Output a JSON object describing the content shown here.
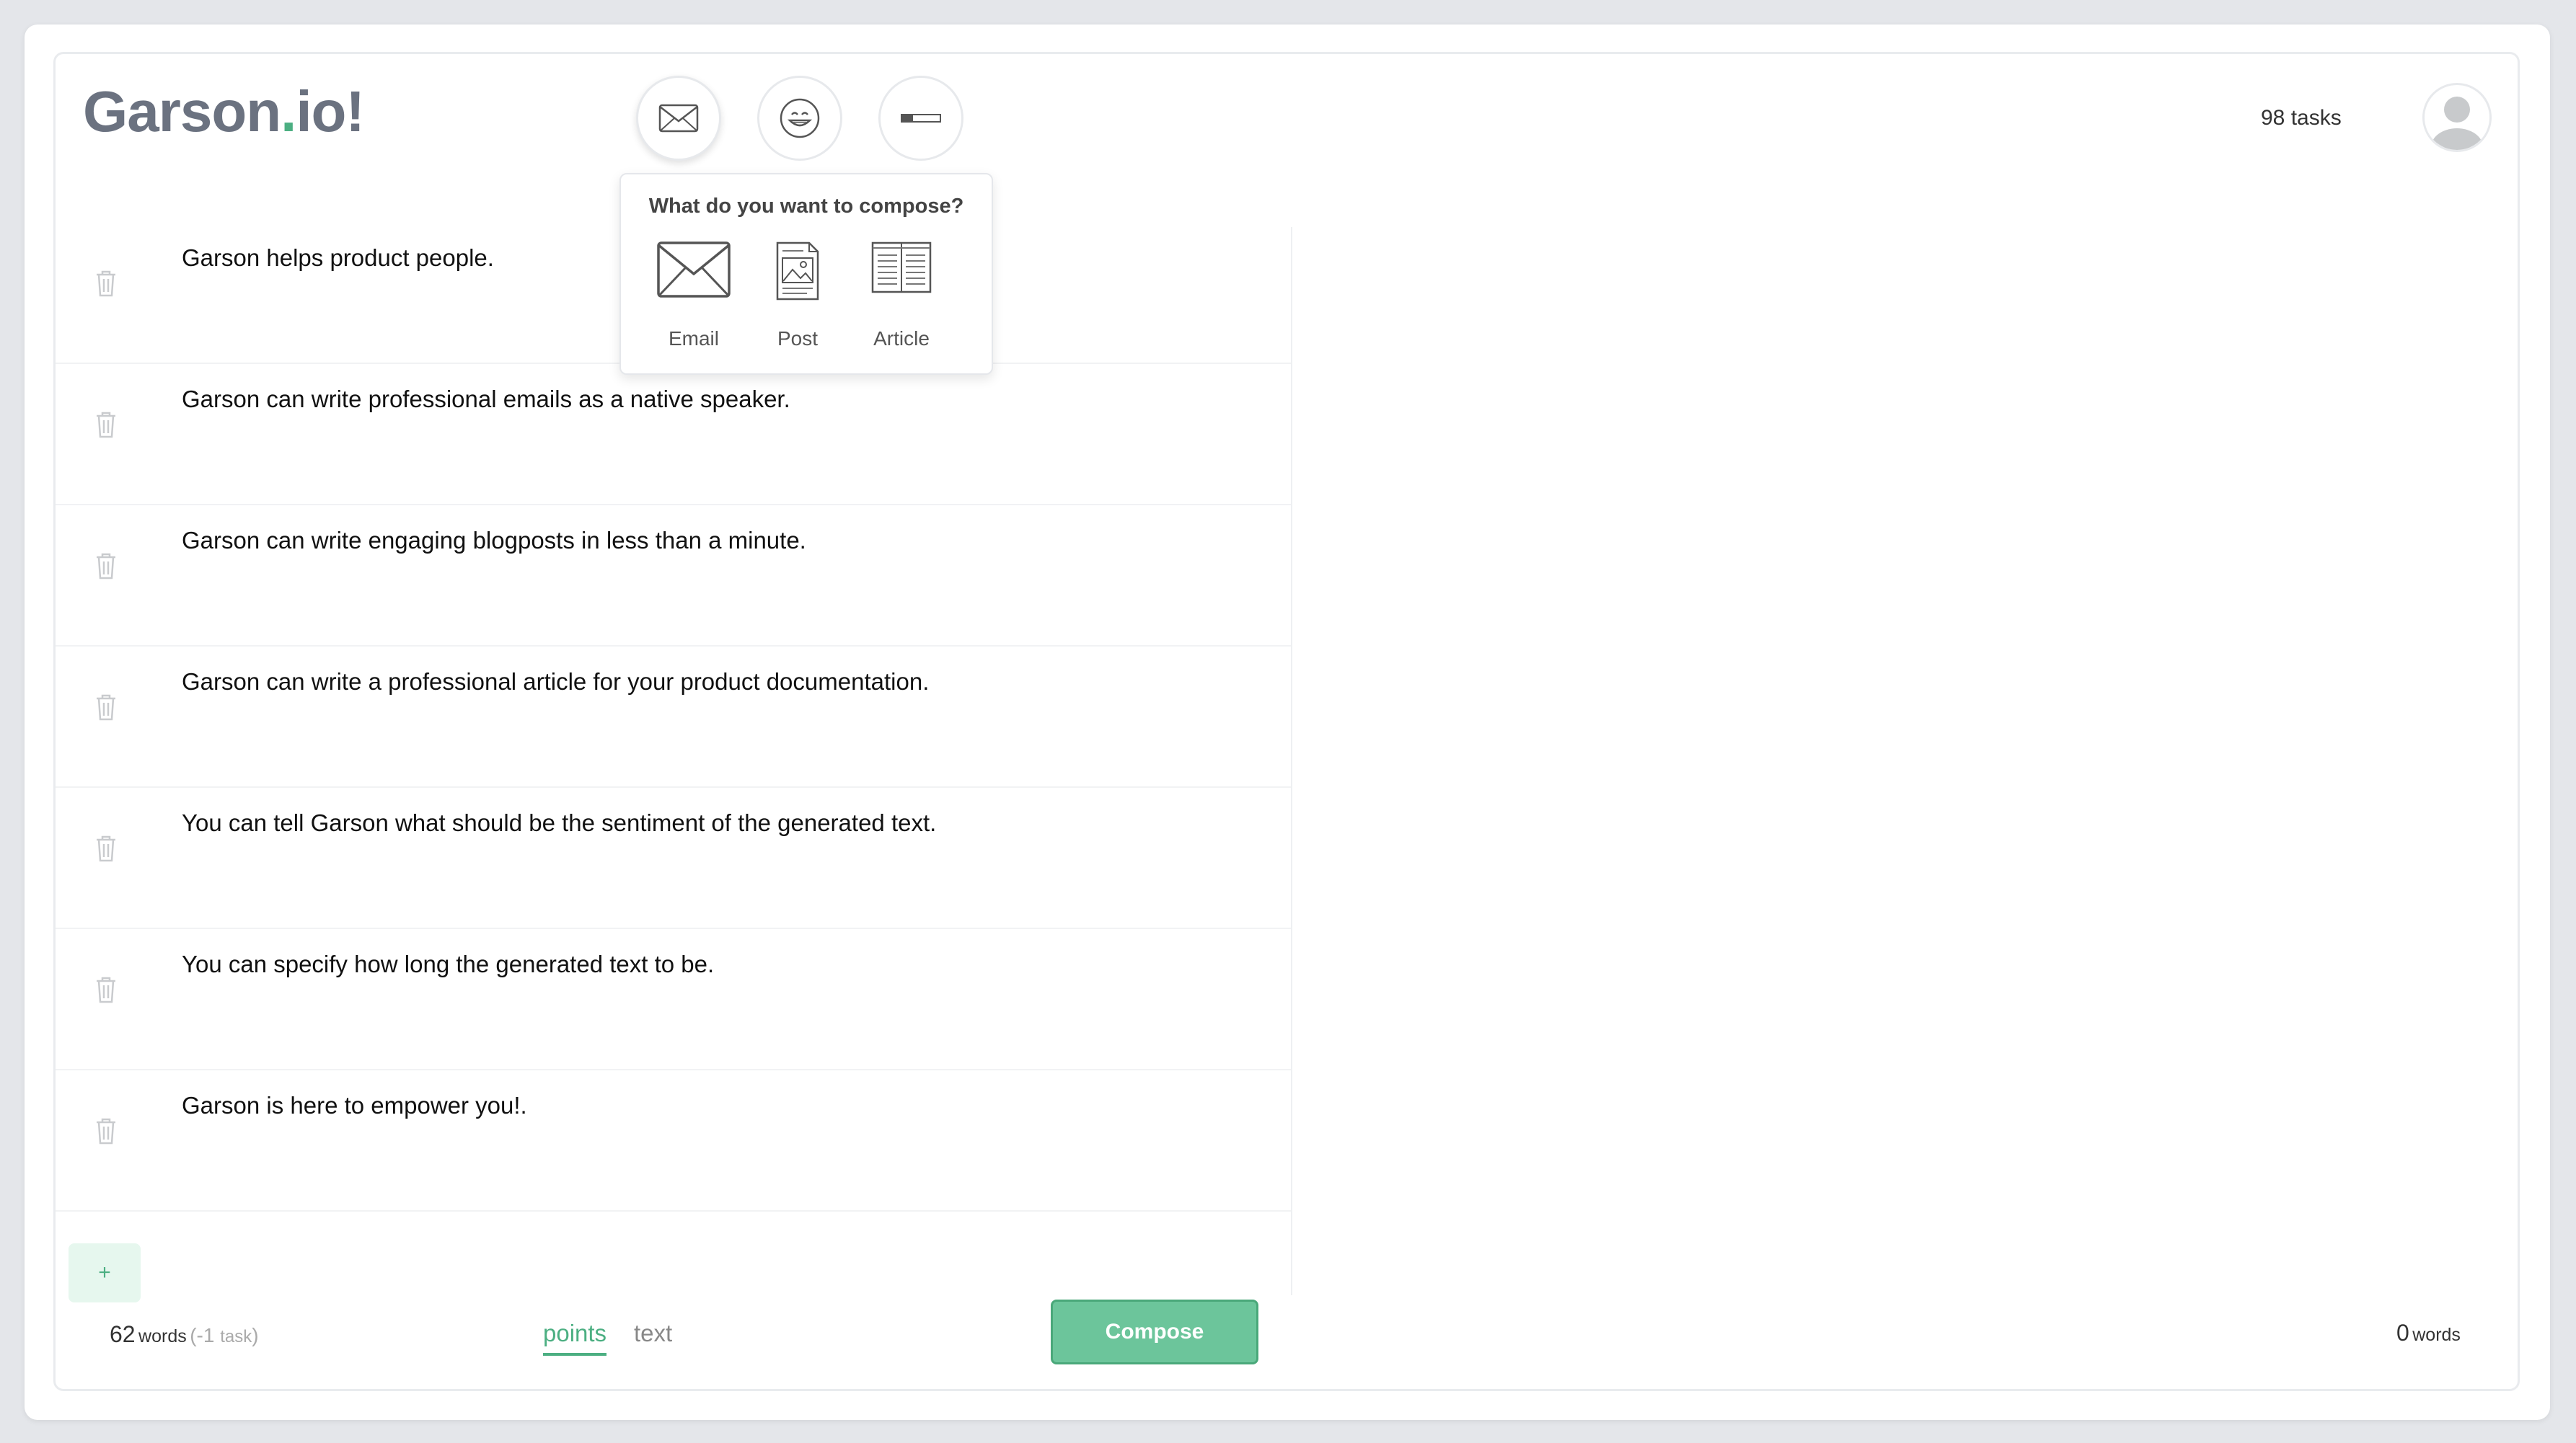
{
  "app": {
    "logo_main": "Garson",
    "logo_dot": ".",
    "logo_rest": "io!",
    "accent_color": "#4caf82"
  },
  "header": {
    "buttons": [
      {
        "icon": "envelope-icon"
      },
      {
        "icon": "smiley-icon"
      },
      {
        "icon": "length-slider-icon"
      }
    ],
    "tasks_label": "98 tasks"
  },
  "popover": {
    "title": "What do you want to compose?",
    "options": [
      {
        "label": "Email",
        "icon": "email-icon"
      },
      {
        "label": "Post",
        "icon": "post-icon"
      },
      {
        "label": "Article",
        "icon": "article-icon"
      }
    ]
  },
  "points": [
    {
      "text": "Garson helps product people."
    },
    {
      "text": "Garson can write professional emails as a native speaker."
    },
    {
      "text": "Garson can write engaging blogposts in less than a minute."
    },
    {
      "text": "Garson can write a professional article for your product documentation."
    },
    {
      "text": "You can tell Garson what should be the sentiment of the generated text."
    },
    {
      "text": "You can specify how long the generated text to be."
    },
    {
      "text": "Garson is here to empower you!."
    }
  ],
  "add_label": "+",
  "footer": {
    "word_count": "62",
    "word_unit": "words",
    "task_delta_open": "(",
    "task_delta_num": "-1",
    "task_delta_unit": "task",
    "task_delta_close": ")",
    "tabs": [
      {
        "label": "points",
        "active": true
      },
      {
        "label": "text",
        "active": false
      }
    ],
    "compose_label": "Compose"
  },
  "output": {
    "word_count": "0",
    "word_unit": "words"
  }
}
